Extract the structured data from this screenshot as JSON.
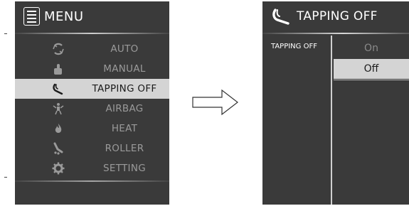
{
  "menu_panel": {
    "title": "MENU",
    "items": [
      {
        "label": "AUTO",
        "icon": "auto-cycle-icon",
        "selected": false
      },
      {
        "label": "MANUAL",
        "icon": "hand-thumb-icon",
        "selected": false
      },
      {
        "label": "TAPPING OFF",
        "icon": "tapping-hand-icon",
        "selected": true
      },
      {
        "label": "AIRBAG",
        "icon": "airbag-body-icon",
        "selected": false
      },
      {
        "label": "HEAT",
        "icon": "flame-icon",
        "selected": false
      },
      {
        "label": "ROLLER",
        "icon": "foot-roller-icon",
        "selected": false
      },
      {
        "label": "SETTING",
        "icon": "gear-icon",
        "selected": false
      }
    ]
  },
  "submenu_panel": {
    "title": "TAPPING OFF",
    "section_label": "TAPPING OFF",
    "options": [
      {
        "label": "On",
        "selected": false
      },
      {
        "label": "Off",
        "selected": true
      }
    ]
  },
  "colors": {
    "panel_bg": "#3a3a3a",
    "selected_bg": "#d4d4d4",
    "inactive_text": "#9a9a9a",
    "active_text": "#ffffff"
  }
}
